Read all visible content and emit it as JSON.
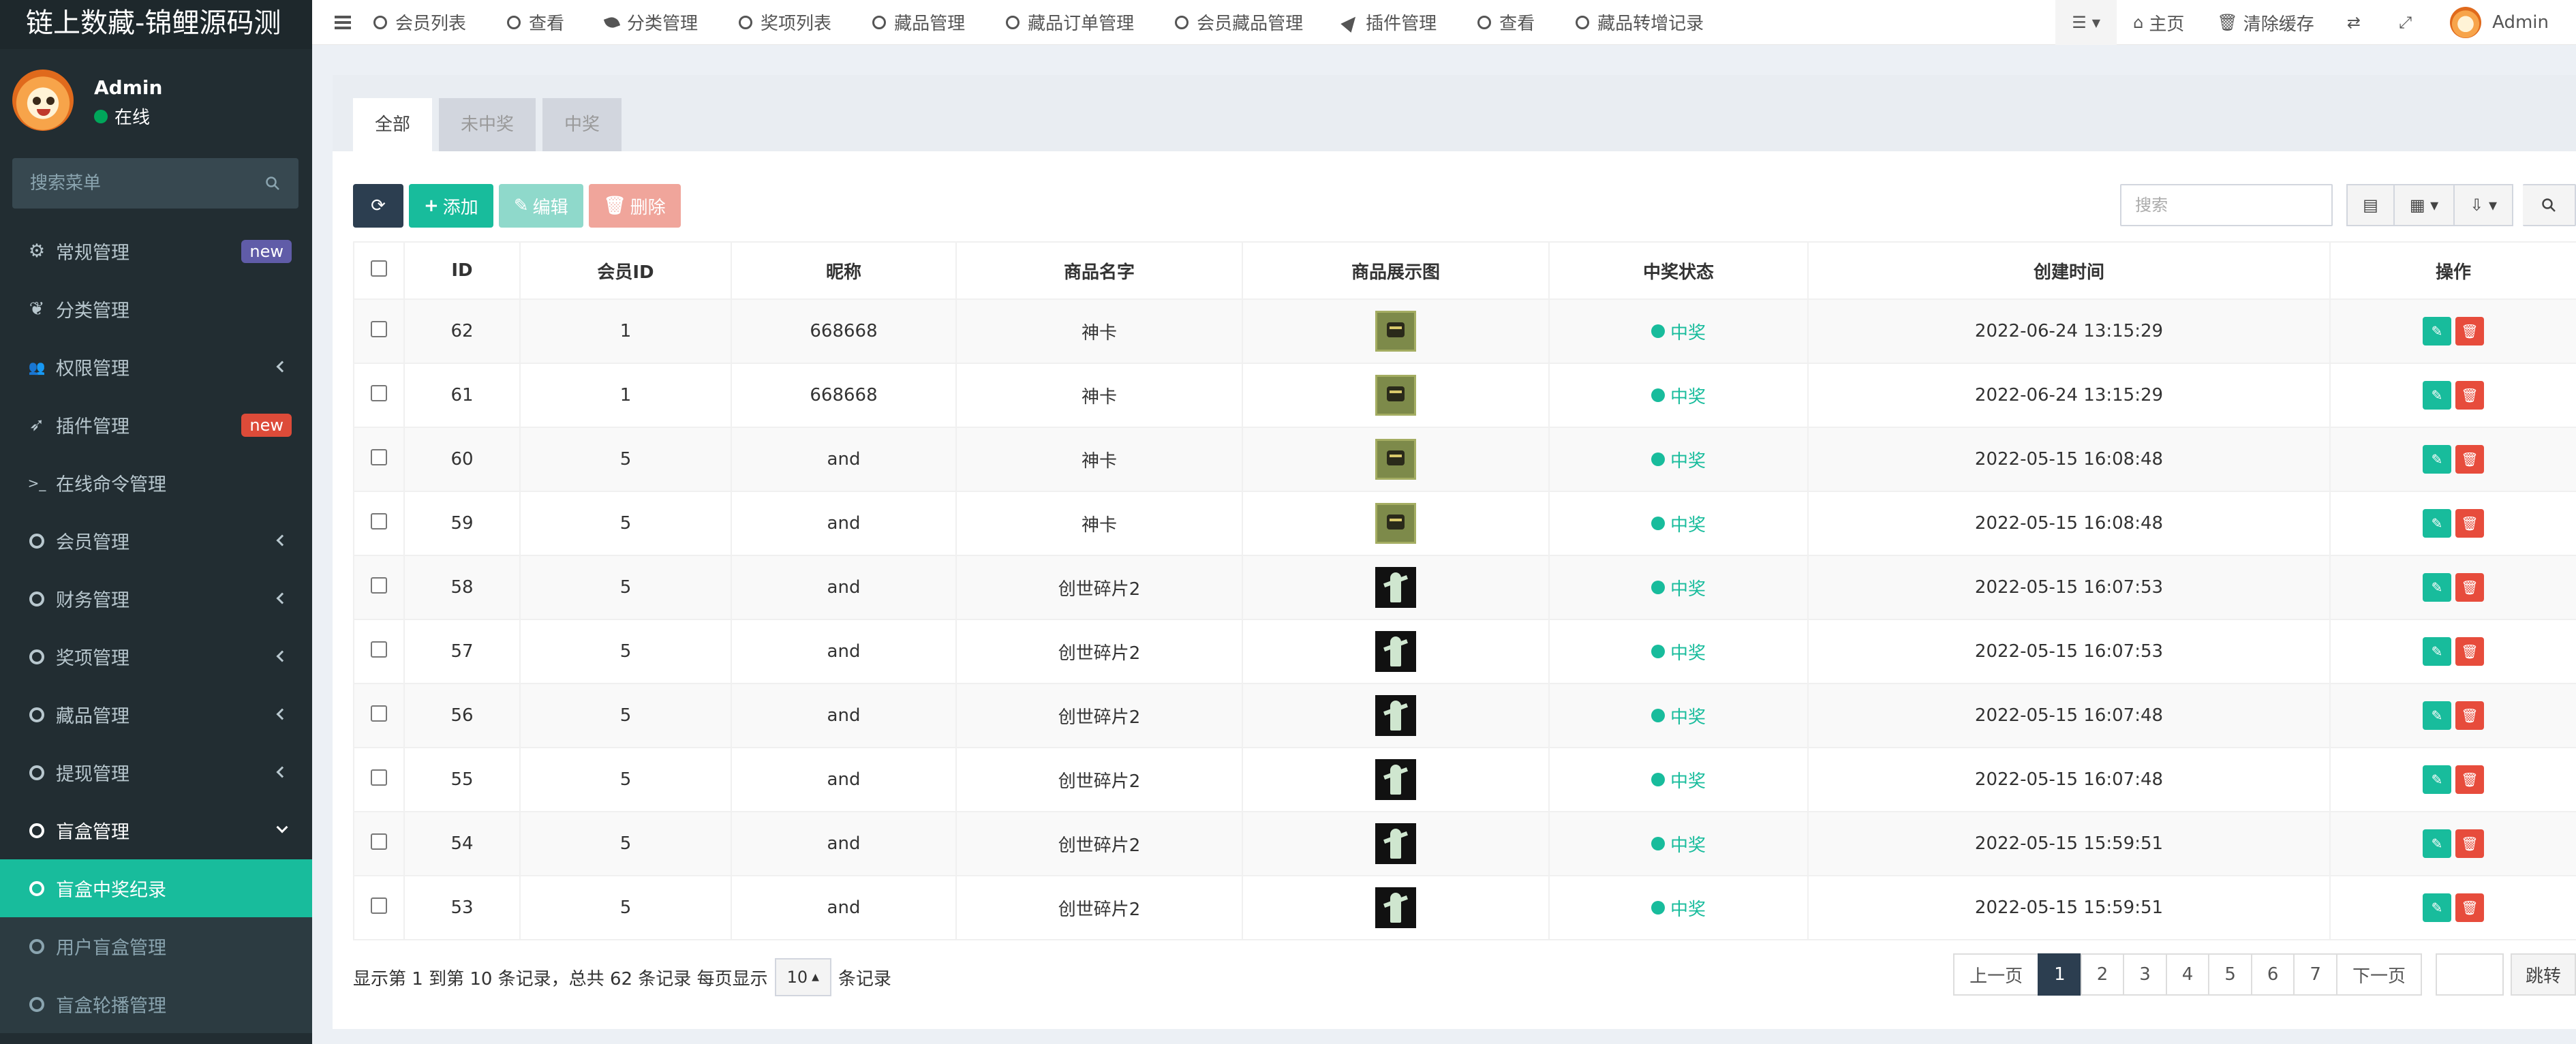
{
  "app_title": "链上数藏-锦鲤源码测",
  "user": {
    "name": "Admin",
    "status": "在线"
  },
  "sidebar": {
    "search_placeholder": "搜索菜单",
    "items": [
      {
        "label": "常规管理",
        "icon": "cogs-icon",
        "badge": "new",
        "badge_color": "#605ca8"
      },
      {
        "label": "分类管理",
        "icon": "leaf-icon"
      },
      {
        "label": "权限管理",
        "icon": "users-icon",
        "chevron": "left"
      },
      {
        "label": "插件管理",
        "icon": "rocket-icon",
        "badge": "new",
        "badge_color": "#dd4b39"
      },
      {
        "label": "在线命令管理",
        "icon": "terminal-icon"
      },
      {
        "label": "会员管理",
        "icon": "circle-icon",
        "chevron": "left"
      },
      {
        "label": "财务管理",
        "icon": "circle-icon",
        "chevron": "left"
      },
      {
        "label": "奖项管理",
        "icon": "circle-icon",
        "chevron": "left"
      },
      {
        "label": "藏品管理",
        "icon": "circle-icon",
        "chevron": "left"
      },
      {
        "label": "提现管理",
        "icon": "circle-icon",
        "chevron": "left"
      },
      {
        "label": "盲盒管理",
        "icon": "circle-icon",
        "chevron": "down"
      },
      {
        "label": "盲盒中奖纪录",
        "icon": "circle-icon",
        "sub": true,
        "active": true
      },
      {
        "label": "用户盲盒管理",
        "icon": "circle-icon",
        "sub": true
      },
      {
        "label": "盲盒轮播管理",
        "icon": "circle-icon",
        "sub": true
      }
    ]
  },
  "topnav": {
    "tabs": [
      {
        "label": "会员列表",
        "icon": "circle-icon"
      },
      {
        "label": "查看",
        "icon": "circle-icon"
      },
      {
        "label": "分类管理",
        "icon": "leaf-icon"
      },
      {
        "label": "奖项列表",
        "icon": "circle-icon"
      },
      {
        "label": "藏品管理",
        "icon": "circle-icon"
      },
      {
        "label": "藏品订单管理",
        "icon": "circle-icon"
      },
      {
        "label": "会员藏品管理",
        "icon": "circle-icon"
      },
      {
        "label": "插件管理",
        "icon": "rocket-icon"
      },
      {
        "label": "查看",
        "icon": "circle-icon"
      },
      {
        "label": "藏品转增记录",
        "icon": "circle-icon"
      }
    ],
    "home_label": "主页",
    "clear_cache_label": "清除缓存",
    "admin_label": "Admin"
  },
  "filter_tabs": [
    "全部",
    "未中奖",
    "中奖"
  ],
  "toolbar": {
    "add_label": "添加",
    "edit_label": "编辑",
    "delete_label": "删除",
    "search_placeholder": "搜索"
  },
  "table": {
    "columns": [
      "ID",
      "会员ID",
      "昵称",
      "商品名字",
      "商品展示图",
      "中奖状态",
      "创建时间",
      "操作"
    ],
    "rows": [
      {
        "id": "62",
        "member_id": "1",
        "nickname": "668668",
        "product": "神卡",
        "image": "card",
        "status": "中奖",
        "created": "2022-06-24 13:15:29"
      },
      {
        "id": "61",
        "member_id": "1",
        "nickname": "668668",
        "product": "神卡",
        "image": "card",
        "status": "中奖",
        "created": "2022-06-24 13:15:29"
      },
      {
        "id": "60",
        "member_id": "5",
        "nickname": "and",
        "product": "神卡",
        "image": "card",
        "status": "中奖",
        "created": "2022-05-15 16:08:48"
      },
      {
        "id": "59",
        "member_id": "5",
        "nickname": "and",
        "product": "神卡",
        "image": "card",
        "status": "中奖",
        "created": "2022-05-15 16:08:48"
      },
      {
        "id": "58",
        "member_id": "5",
        "nickname": "and",
        "product": "创世碎片2",
        "image": "shard",
        "status": "中奖",
        "created": "2022-05-15 16:07:53"
      },
      {
        "id": "57",
        "member_id": "5",
        "nickname": "and",
        "product": "创世碎片2",
        "image": "shard",
        "status": "中奖",
        "created": "2022-05-15 16:07:53"
      },
      {
        "id": "56",
        "member_id": "5",
        "nickname": "and",
        "product": "创世碎片2",
        "image": "shard",
        "status": "中奖",
        "created": "2022-05-15 16:07:48"
      },
      {
        "id": "55",
        "member_id": "5",
        "nickname": "and",
        "product": "创世碎片2",
        "image": "shard",
        "status": "中奖",
        "created": "2022-05-15 16:07:48"
      },
      {
        "id": "54",
        "member_id": "5",
        "nickname": "and",
        "product": "创世碎片2",
        "image": "shard",
        "status": "中奖",
        "created": "2022-05-15 15:59:51"
      },
      {
        "id": "53",
        "member_id": "5",
        "nickname": "and",
        "product": "创世碎片2",
        "image": "shard",
        "status": "中奖",
        "created": "2022-05-15 15:59:51"
      }
    ]
  },
  "footer": {
    "summary": "显示第 1 到第 10 条记录，总共 62 条记录 每页显示",
    "page_size": "10",
    "records_suffix": "条记录"
  },
  "pagination": {
    "prev_label": "上一页",
    "pages": [
      "1",
      "2",
      "3",
      "4",
      "5",
      "6",
      "7"
    ],
    "current": "1",
    "next_label": "下一页",
    "jump_label": "跳转"
  },
  "colors": {
    "accent": "#18bc9c",
    "sidebar_bg": "#222d32",
    "danger": "#e74c3c",
    "dark": "#2c3e50"
  }
}
